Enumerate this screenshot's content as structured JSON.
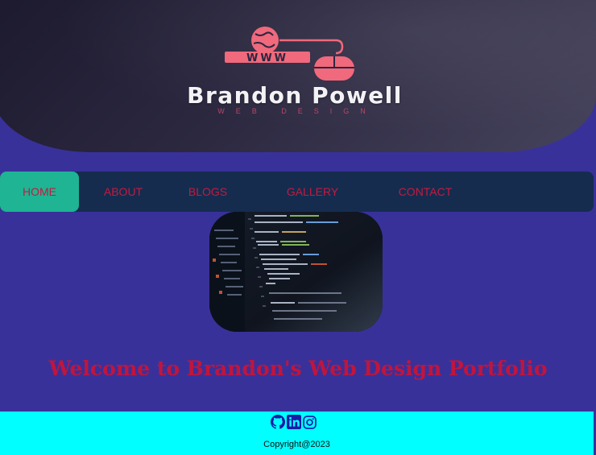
{
  "header": {
    "brand_name": "Brandon Powell",
    "tagline": "WEB DESIGN",
    "logo_text": "WWW"
  },
  "nav": {
    "items": [
      {
        "label": "HOME",
        "active": true
      },
      {
        "label": "ABOUT",
        "active": false
      },
      {
        "label": "BLOGS",
        "active": false
      },
      {
        "label": "GALLERY",
        "active": false
      },
      {
        "label": "CONTACT",
        "active": false
      }
    ]
  },
  "main": {
    "hero_image": "code-editor-screen",
    "welcome_heading": "Welcome to Brandon's Web Design Portfolio"
  },
  "footer": {
    "social": [
      "github-icon",
      "linkedin-icon",
      "instagram-icon"
    ],
    "copyright": "Copyright@2023"
  },
  "colors": {
    "background": "#39319a",
    "nav_bg": "#152c4f",
    "nav_active": "#1fb494",
    "nav_text": "#c31b3f",
    "heading": "#c0153d",
    "footer_bg": "#00ffff",
    "logo_pink": "#f0697c"
  }
}
